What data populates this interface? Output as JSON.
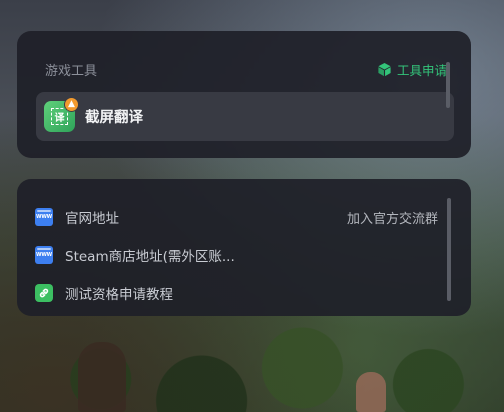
{
  "tools_panel": {
    "title": "游戏工具",
    "apply_label": "工具申请",
    "items": [
      {
        "label": "截屏翻译",
        "icon": "screenshot-translate-icon",
        "icon_char": "译"
      }
    ]
  },
  "links_panel": {
    "items": [
      {
        "label": "官网地址",
        "icon": "www-icon",
        "action_label": "加入官方交流群"
      },
      {
        "label": "Steam商店地址(需外区账...",
        "icon": "www-icon"
      },
      {
        "label": "测试资格申请教程",
        "icon": "link-icon"
      }
    ]
  },
  "icon_text": {
    "www": "WWW"
  },
  "colors": {
    "accent_green": "#33c47a",
    "panel_bg": "#1e2028",
    "www_blue": "#3d7ff0",
    "link_green": "#3cbf62",
    "badge_orange": "#f29a2e"
  }
}
